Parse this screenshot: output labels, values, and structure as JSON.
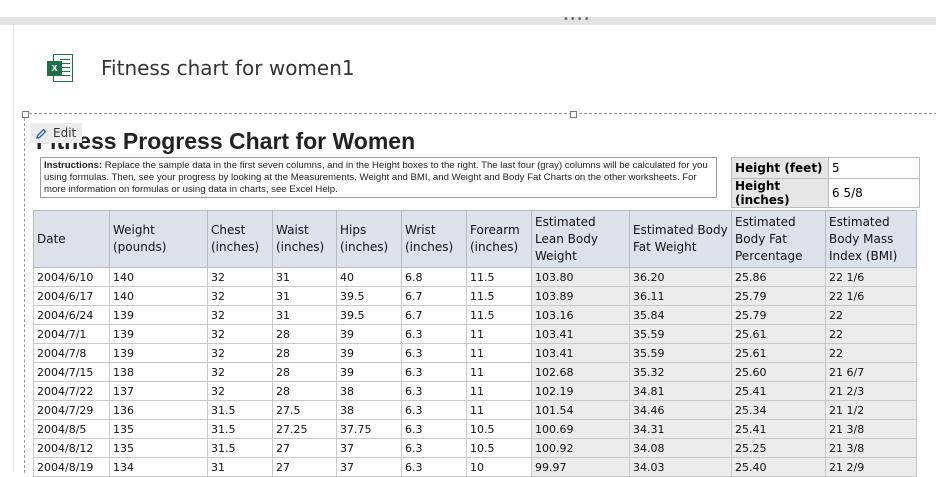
{
  "document": {
    "title": "Fitness chart for women1"
  },
  "toolbar": {
    "edit_label": "Edit"
  },
  "sheet": {
    "title": "Fitness Progress Chart for Women",
    "instructions_bold": "Instructions:",
    "instructions_text": " Replace the sample data in the first seven columns, and in the Height boxes to the right. The last four (gray) columns will be calculated for you using formulas. Then, see your progress by looking at the Measurements, Weight and BMI, and Weight and Body Fat Charts on the other worksheets. For more information on formulas or using data in charts, see Excel Help.",
    "height_feet_label": "Height (feet)",
    "height_feet_value": "5",
    "height_inches_label": "Height (inches)",
    "height_inches_value": "6 5/8"
  },
  "table": {
    "headers": [
      "Date",
      "Weight (pounds)",
      "Chest (inches)",
      "Waist (inches)",
      "Hips (inches)",
      "Wrist (inches)",
      "Forearm (inches)",
      "Estimated Lean Body Weight",
      "Estimated Body Fat Weight",
      "Estimated Body Fat Percentage",
      "Estimated Body Mass Index (BMI)"
    ],
    "rows": [
      [
        "2004/6/10",
        "140",
        "32",
        "31",
        "40",
        "6.8",
        "11.5",
        "103.80",
        "36.20",
        "25.86",
        "22 1/6"
      ],
      [
        "2004/6/17",
        "140",
        "32",
        "31",
        "39.5",
        "6.7",
        "11.5",
        "103.89",
        "36.11",
        "25.79",
        "22 1/6"
      ],
      [
        "2004/6/24",
        "139",
        "32",
        "31",
        "39.5",
        "6.7",
        "11.5",
        "103.16",
        "35.84",
        "25.79",
        "22"
      ],
      [
        "2004/7/1",
        "139",
        "32",
        "28",
        "39",
        "6.3",
        "11",
        "103.41",
        "35.59",
        "25.61",
        "22"
      ],
      [
        "2004/7/8",
        "139",
        "32",
        "28",
        "39",
        "6.3",
        "11",
        "103.41",
        "35.59",
        "25.61",
        "22"
      ],
      [
        "2004/7/15",
        "138",
        "32",
        "28",
        "39",
        "6.3",
        "11",
        "102.68",
        "35.32",
        "25.60",
        "21 6/7"
      ],
      [
        "2004/7/22",
        "137",
        "32",
        "28",
        "38",
        "6.3",
        "11",
        "102.19",
        "34.81",
        "25.41",
        "21 2/3"
      ],
      [
        "2004/7/29",
        "136",
        "31.5",
        "27.5",
        "38",
        "6.3",
        "11",
        "101.54",
        "34.46",
        "25.34",
        "21 1/2"
      ],
      [
        "2004/8/5",
        "135",
        "31.5",
        "27.25",
        "37.75",
        "6.3",
        "10.5",
        "100.69",
        "34.31",
        "25.41",
        "21 3/8"
      ],
      [
        "2004/8/12",
        "135",
        "31.5",
        "27",
        "37",
        "6.3",
        "10.5",
        "100.92",
        "34.08",
        "25.25",
        "21 3/8"
      ],
      [
        "2004/8/19",
        "134",
        "31",
        "27",
        "37",
        "6.3",
        "10",
        "99.97",
        "34.03",
        "25.40",
        "21 2/9"
      ]
    ]
  },
  "colors": {
    "header_fill": "#dde2ea",
    "calc_fill": "#ebebeb",
    "excel_green": "#1e7145"
  },
  "icons": [
    "excel-file-icon",
    "pencil-icon",
    "resize-grip-icon"
  ]
}
